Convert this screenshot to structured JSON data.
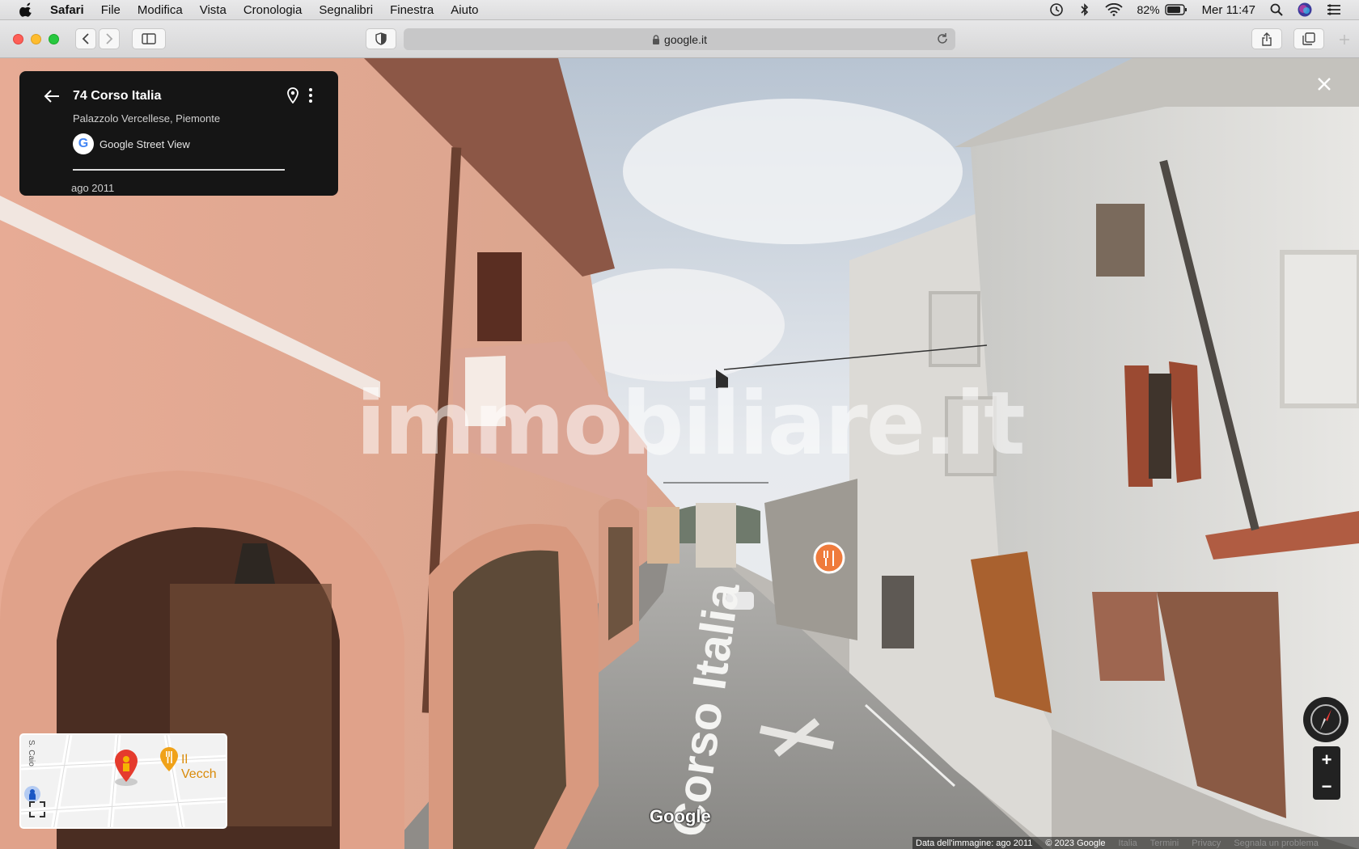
{
  "menubar": {
    "app_name": "Safari",
    "items": [
      "File",
      "Modifica",
      "Vista",
      "Cronologia",
      "Segnalibri",
      "Finestra",
      "Aiuto"
    ],
    "battery": "82%",
    "clock": "Mer 11:47"
  },
  "toolbar": {
    "url": "google.it"
  },
  "streetview": {
    "watermark": "immobiliare.it",
    "info": {
      "title": "74 Corso Italia",
      "subtitle": "Palazzolo Vercellese, Piemonte",
      "source": "Google Street View",
      "date": "ago 2011"
    },
    "minimap": {
      "street_label": "S. Caio",
      "place_label": "Il Vecch"
    },
    "road_marking": "Corso Italia",
    "google_logo": "Google",
    "zoom_in": "+",
    "zoom_out": "−",
    "footer": {
      "image_date": "Data dell'immagine: ago 2011",
      "copyright": "© 2023 Google",
      "links": [
        "Italia",
        "Termini",
        "Privacy",
        "Segnala un problema"
      ]
    }
  },
  "colors": {
    "facade_left": "#e2a58c",
    "facade_right": "#e3e2df",
    "sky": "#dfe4ea",
    "road": "#9b9b99",
    "card_bg": "#151515",
    "traffic_red": "#fe5f57",
    "traffic_yellow": "#febc2e",
    "traffic_green": "#28c840"
  }
}
